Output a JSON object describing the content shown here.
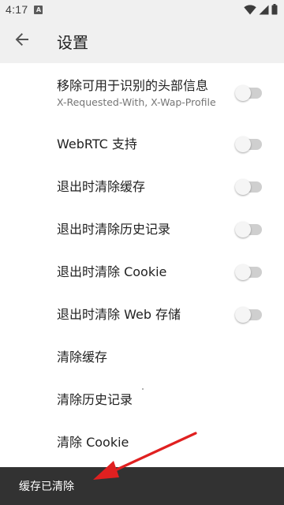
{
  "status_bar": {
    "time": "4:17",
    "notification_icon": "a-badge-icon",
    "wifi_icon": "wifi-icon",
    "signal_icon": "signal-icon",
    "battery_icon": "battery-icon"
  },
  "app_bar": {
    "back_icon": "arrow-left-icon",
    "title": "设置"
  },
  "settings": {
    "items": [
      {
        "title": "移除可用于识别的头部信息",
        "summary": "X-Requested-With, X-Wap-Profile",
        "has_toggle": true,
        "checked": false
      },
      {
        "title": "WebRTC 支持",
        "summary": "",
        "has_toggle": true,
        "checked": false
      },
      {
        "title": "退出时清除缓存",
        "summary": "",
        "has_toggle": true,
        "checked": false
      },
      {
        "title": "退出时清除历史记录",
        "summary": "",
        "has_toggle": true,
        "checked": false
      },
      {
        "title": "退出时清除 Cookie",
        "summary": "",
        "has_toggle": true,
        "checked": false
      },
      {
        "title": "退出时清除 Web 存储",
        "summary": "",
        "has_toggle": true,
        "checked": false
      },
      {
        "title": "清除缓存",
        "summary": "",
        "has_toggle": false
      },
      {
        "title": "清除历史记录",
        "summary": "",
        "has_toggle": false
      },
      {
        "title": "清除 Cookie",
        "summary": "",
        "has_toggle": false
      }
    ]
  },
  "snackbar": {
    "message": "缓存已清除"
  },
  "colors": {
    "app_bar_bg": "#f0f0f0",
    "snackbar_bg": "#323232",
    "annotation_arrow": "#e02020",
    "toggle_track_off": "#cfcfcf",
    "toggle_thumb_off": "#f5f5f5"
  }
}
